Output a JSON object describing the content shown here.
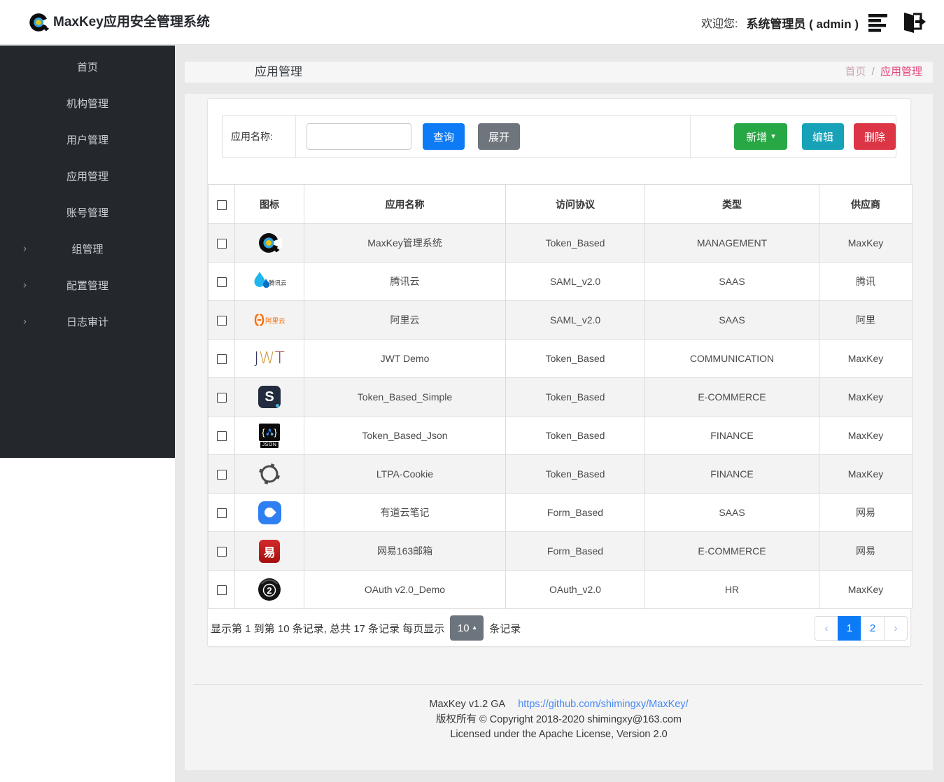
{
  "header": {
    "brand": "MaxKey应用安全管理系统",
    "welcome": "欢迎您:",
    "user": "系统管理员 ( admin )"
  },
  "sidebar": {
    "items": [
      {
        "key": "home",
        "label": "首页",
        "expandable": false
      },
      {
        "key": "org",
        "label": "机构管理",
        "expandable": false
      },
      {
        "key": "user",
        "label": "用户管理",
        "expandable": false
      },
      {
        "key": "app",
        "label": "应用管理",
        "expandable": false
      },
      {
        "key": "account",
        "label": "账号管理",
        "expandable": false
      },
      {
        "key": "group",
        "label": "组管理",
        "expandable": true
      },
      {
        "key": "config",
        "label": "配置管理",
        "expandable": true
      },
      {
        "key": "audit",
        "label": "日志审计",
        "expandable": true
      }
    ]
  },
  "page": {
    "title": "应用管理",
    "breadcrumb_home": "首页",
    "breadcrumb_sep": "/",
    "breadcrumb_current": "应用管理"
  },
  "toolbar": {
    "search_label": "应用名称:",
    "search_value": "",
    "query_label": "查询",
    "expand_label": "展开",
    "add_label": "新增",
    "edit_label": "编辑",
    "delete_label": "删除"
  },
  "table": {
    "columns": [
      "图标",
      "应用名称",
      "访问协议",
      "类型",
      "供应商"
    ],
    "rows": [
      {
        "icon": "maxkey",
        "name": "MaxKey管理系统",
        "protocol": "Token_Based",
        "category": "MANAGEMENT",
        "vendor": "MaxKey"
      },
      {
        "icon": "tencent",
        "name": "腾讯云",
        "protocol": "SAML_v2.0",
        "category": "SAAS",
        "vendor": "腾讯"
      },
      {
        "icon": "aliyun",
        "name": "阿里云",
        "protocol": "SAML_v2.0",
        "category": "SAAS",
        "vendor": "阿里"
      },
      {
        "icon": "jwt",
        "name": "JWT Demo",
        "protocol": "Token_Based",
        "category": "COMMUNICATION",
        "vendor": "MaxKey"
      },
      {
        "icon": "simple",
        "name": "Token_Based_Simple",
        "protocol": "Token_Based",
        "category": "E-COMMERCE",
        "vendor": "MaxKey"
      },
      {
        "icon": "json",
        "name": "Token_Based_Json",
        "protocol": "Token_Based",
        "category": "FINANCE",
        "vendor": "MaxKey"
      },
      {
        "icon": "ltpa",
        "name": "LTPA-Cookie",
        "protocol": "Token_Based",
        "category": "FINANCE",
        "vendor": "MaxKey"
      },
      {
        "icon": "youdao",
        "name": "有道云笔记",
        "protocol": "Form_Based",
        "category": "SAAS",
        "vendor": "网易"
      },
      {
        "icon": "netease163",
        "name": "网易163邮箱",
        "protocol": "Form_Based",
        "category": "E-COMMERCE",
        "vendor": "网易"
      },
      {
        "icon": "oauth2",
        "name": "OAuth v2.0_Demo",
        "protocol": "OAuth_v2.0",
        "category": "HR",
        "vendor": "MaxKey"
      }
    ]
  },
  "pagination": {
    "summary_prefix": "显示第 1 到第 10 条记录, 总共 17 条记录  每页显示",
    "page_size": "10",
    "summary_suffix": "条记录",
    "prev": "‹",
    "next": "›",
    "pages": [
      "1",
      "2"
    ],
    "active": "1"
  },
  "footer": {
    "version": "MaxKey  v1.2 GA",
    "link": "https://github.com/shimingxy/MaxKey/",
    "copyright": "版权所有 © Copyright 2018-2020 shimingxy@163.com",
    "license": "Licensed under the Apache License, Version 2.0"
  },
  "icon_glyphs": {
    "chevron": "›",
    "caret_down": "▾",
    "caret_up": "▴",
    "jwt": "JWT",
    "simple": "S",
    "json_label": "JSON",
    "tencent": "腾讯云",
    "aliyun": "阿里云",
    "netease": "易",
    "oauth2": "2"
  },
  "colors": {
    "primary": "#0e7bf6",
    "secondary": "#6e757c",
    "success": "#28a745",
    "info": "#17a2b8",
    "danger": "#dc3545",
    "sidebar_bg": "#24282c",
    "breadcrumb_active": "#e5447e",
    "stripe": "#f3f3f3",
    "link": "#4687f0"
  }
}
